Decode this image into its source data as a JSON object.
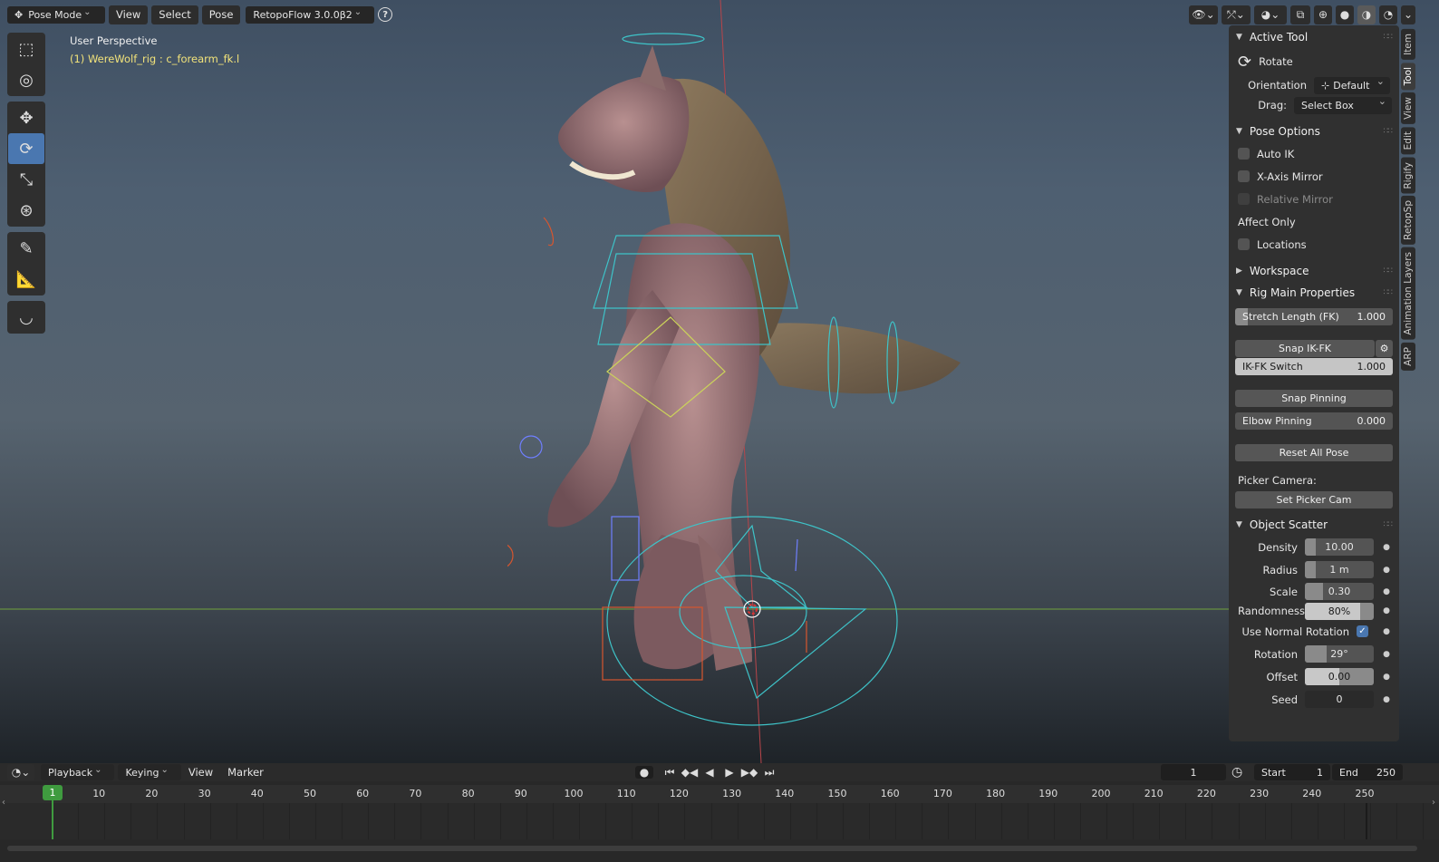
{
  "header": {
    "mode": "Pose Mode",
    "menus": [
      "View",
      "Select",
      "Pose"
    ],
    "addon": "RetopoFlow 3.0.0β2",
    "help_icon": "?"
  },
  "viewport": {
    "perspective": "User Perspective",
    "active_object": "(1) WereWolf_rig : c_forearm_fk.l"
  },
  "toolbar": {
    "tools": [
      "select-box",
      "cursor",
      "move",
      "rotate",
      "scale",
      "transform",
      "annotate",
      "measure",
      "bone-envelope"
    ],
    "active": "rotate"
  },
  "side_tabs": [
    "Item",
    "Tool",
    "View",
    "Edit",
    "Rigify",
    "RetopSp",
    "Animation Layers",
    "ARP"
  ],
  "panel": {
    "active_tool": {
      "title": "Active Tool",
      "tool": "Rotate",
      "orientation_label": "Orientation",
      "orientation_value": "Default",
      "drag_label": "Drag:",
      "drag_value": "Select Box"
    },
    "pose_options": {
      "title": "Pose Options",
      "auto_ik": "Auto IK",
      "x_axis_mirror": "X-Axis Mirror",
      "relative_mirror": "Relative Mirror",
      "affect_only": "Affect Only",
      "locations": "Locations"
    },
    "workspace": {
      "title": "Workspace"
    },
    "rig_main": {
      "title": "Rig Main Properties",
      "stretch_label": "Stretch Length (FK)",
      "stretch_value": "1.000",
      "snap_ikfk": "Snap IK-FK",
      "ikfk_label": "IK-FK Switch",
      "ikfk_value": "1.000",
      "snap_pinning": "Snap Pinning",
      "elbow_label": "Elbow Pinning",
      "elbow_value": "0.000",
      "reset_pose": "Reset All Pose",
      "picker_camera": "Picker Camera:",
      "set_picker_cam": "Set Picker Cam"
    },
    "object_scatter": {
      "title": "Object Scatter",
      "density_label": "Density",
      "density_value": "10.00",
      "radius_label": "Radius",
      "radius_value": "1 m",
      "scale_label": "Scale",
      "scale_value": "0.30",
      "randomness_label": "Randomness",
      "randomness_value": "80%",
      "normal_rotation_label": "Use Normal Rotation",
      "rotation_label": "Rotation",
      "rotation_value": "29°",
      "offset_label": "Offset",
      "offset_value": "0.00",
      "seed_label": "Seed",
      "seed_value": "0"
    }
  },
  "timeline": {
    "menus": {
      "playback": "Playback",
      "keying": "Keying",
      "view": "View",
      "marker": "Marker"
    },
    "current_frame": "1",
    "start_label": "Start",
    "start_value": "1",
    "end_label": "End",
    "end_value": "250",
    "ruler": [
      "10",
      "20",
      "30",
      "40",
      "50",
      "60",
      "70",
      "80",
      "90",
      "100",
      "110",
      "120",
      "130",
      "140",
      "150",
      "160",
      "170",
      "180",
      "190",
      "200",
      "210",
      "220",
      "230",
      "240",
      "250"
    ],
    "ruler_current": "1"
  }
}
